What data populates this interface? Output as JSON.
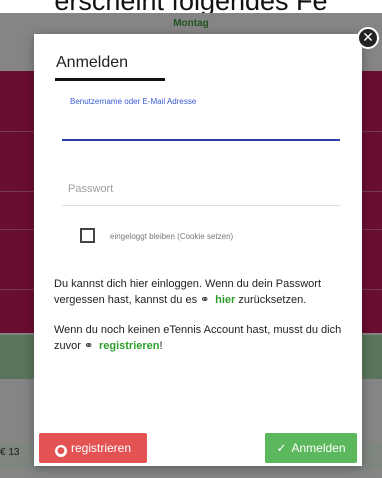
{
  "background": {
    "caption": "erscheint folgendes Fe",
    "day_label": "Montag",
    "price_fragment": "€ 13"
  },
  "modal": {
    "title": "Anmelden",
    "username_label": "Benutzername oder E-Mail Adresse",
    "username_value": "",
    "password_placeholder": "Passwort",
    "remember_label": "eingeloggt bleiben (Cookie setzen)",
    "remember_checked": false,
    "info1_prefix": "Du kannst dich hier einloggen. Wenn du dein Passwort vergessen hast, kannst du es",
    "info1_link": "hier",
    "info1_suffix": "zurücksetzen.",
    "info2_prefix": "Wenn du noch keinen eTennis Account hast, musst du dich zuvor",
    "info2_link": "registrieren",
    "info2_suffix": "!",
    "register_label": "registrieren",
    "login_label": "Anmelden",
    "close_symbol": "✕"
  },
  "colors": {
    "accent_pink": "#c2185b",
    "link_green": "#2e9e2e",
    "register_red": "#e45353",
    "login_green": "#5cb85c",
    "input_focus_blue": "#2b3fae"
  },
  "icons": {
    "close": "close-icon",
    "link": "link-icon",
    "register": "user-circle-icon",
    "login": "checkmark-icon"
  }
}
